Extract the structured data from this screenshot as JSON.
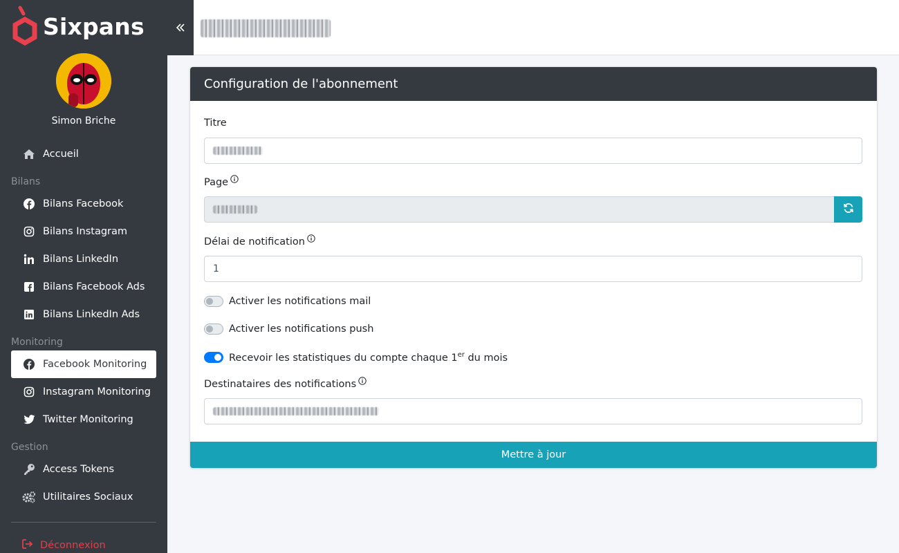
{
  "brand": {
    "name": "Sixpans",
    "color": "#e8404c"
  },
  "user": {
    "name": "Simon Briche"
  },
  "sidebar": {
    "home": {
      "label": "Accueil",
      "icon": "home-icon"
    },
    "sections": [
      {
        "header": "Bilans",
        "items": [
          {
            "label": "Bilans Facebook",
            "icon": "facebook-icon"
          },
          {
            "label": "Bilans Instagram",
            "icon": "instagram-icon"
          },
          {
            "label": "Bilans LinkedIn",
            "icon": "linkedin-icon"
          },
          {
            "label": "Bilans Facebook Ads",
            "icon": "facebook-square-icon"
          },
          {
            "label": "Bilans LinkedIn Ads",
            "icon": "linkedin-square-icon"
          }
        ]
      },
      {
        "header": "Monitoring",
        "items": [
          {
            "label": "Facebook Monitoring",
            "icon": "facebook-icon",
            "active": true
          },
          {
            "label": "Instagram Monitoring",
            "icon": "instagram-icon"
          },
          {
            "label": "Twitter Monitoring",
            "icon": "twitter-icon"
          }
        ]
      },
      {
        "header": "Gestion",
        "items": [
          {
            "label": "Access Tokens",
            "icon": "key-icon"
          },
          {
            "label": "Utilitaires Sociaux",
            "icon": "cogs-icon"
          }
        ]
      }
    ],
    "logout": {
      "label": "Déconnexion",
      "icon": "sign-out-icon"
    }
  },
  "card": {
    "title": "Configuration de l'abonnement",
    "fields": {
      "titre_label": "Titre",
      "page_label": "Page",
      "delai_label": "Délai de notification",
      "delai_value": "1",
      "destinataires_label": "Destinataires des notifications"
    },
    "toggles": {
      "mail_label": "Activer les notifications mail",
      "mail_on": false,
      "push_label": "Activer les notifications push",
      "push_on": false,
      "stats_label_pre": "Recevoir les statistiques du compte chaque 1",
      "stats_label_sup": "er",
      "stats_label_post": " du mois",
      "stats_on": true
    },
    "submit_label": "Mettre à jour"
  },
  "colors": {
    "sidebar_bg": "#343a40",
    "accent": "#17a2b8",
    "toggle_on": "#007bff"
  }
}
